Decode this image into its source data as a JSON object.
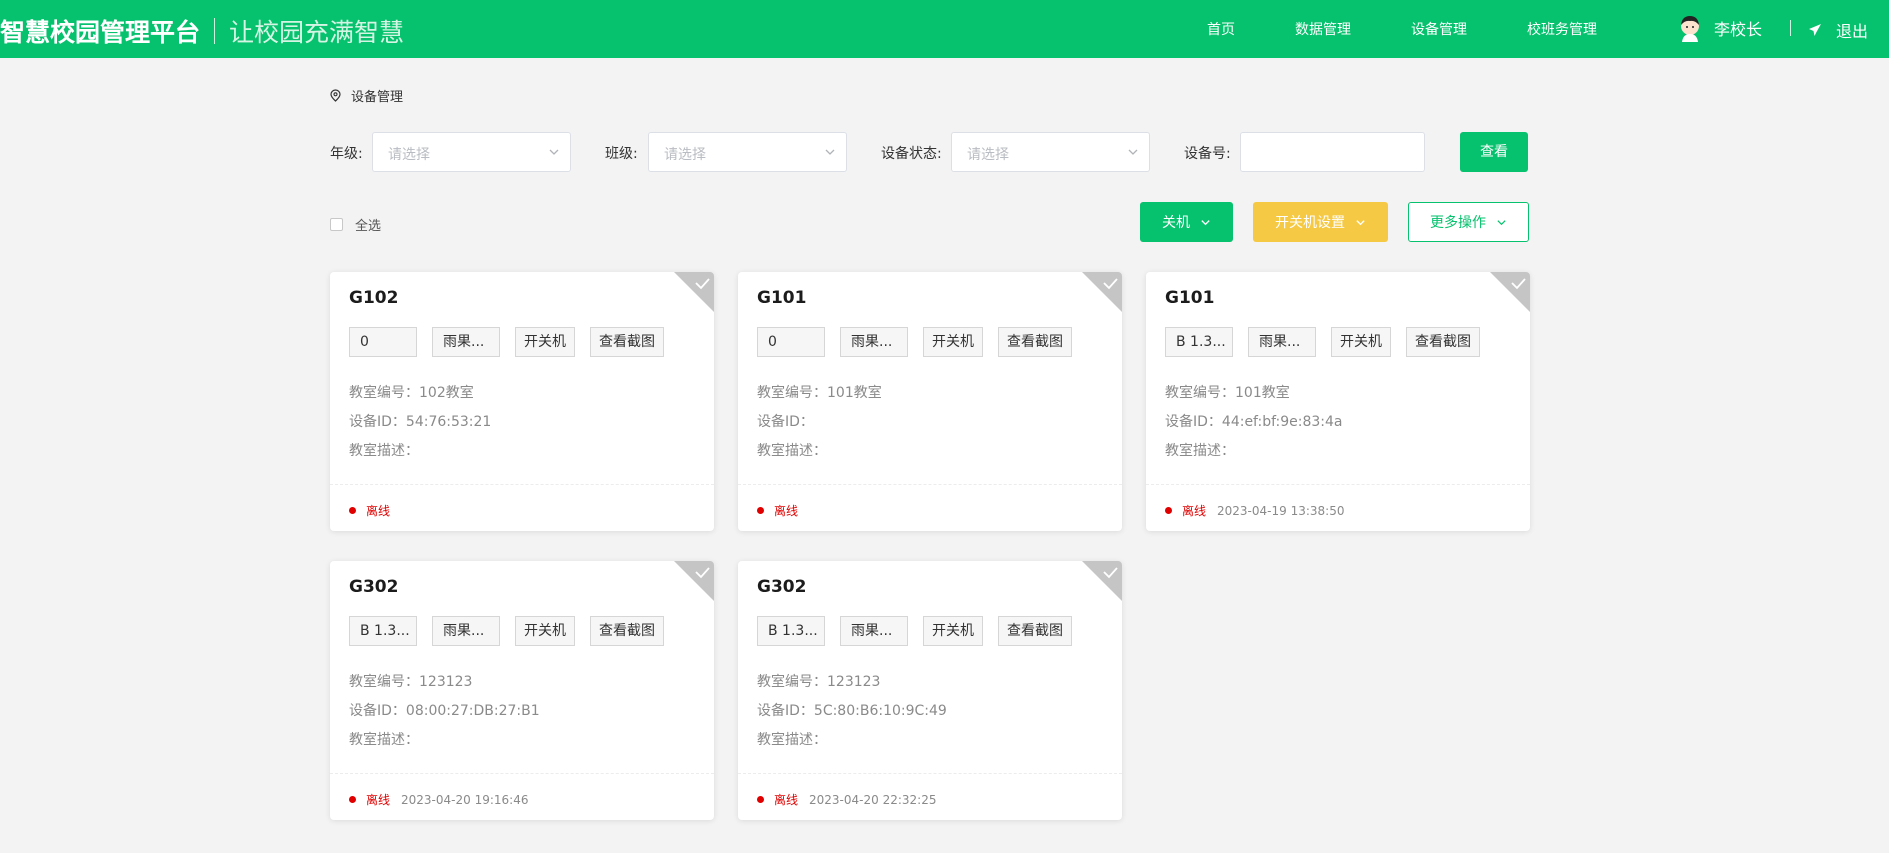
{
  "header": {
    "title": "智慧校园管理平台",
    "slogan": "让校园充满智慧",
    "nav": [
      "首页",
      "数据管理",
      "设备管理",
      "校班务管理"
    ],
    "user_name": "李校长",
    "logout": "退出",
    "icons": {
      "avatar": "user-avatar",
      "logout": "paper-plane-icon"
    }
  },
  "breadcrumb": {
    "icon": "location-pin-icon",
    "text": "设备管理"
  },
  "filters": {
    "grade_label": "年级:",
    "grade_placeholder": "请选择",
    "class_label": "班级:",
    "class_placeholder": "请选择",
    "status_label": "设备状态:",
    "status_placeholder": "请选择",
    "device_label": "设备号:",
    "device_value": "",
    "search_button": "查看"
  },
  "actions": {
    "select_all": "全选",
    "power_off": "关机",
    "schedule": "开关机设置",
    "more": "更多操作"
  },
  "colors": {
    "primary": "#06c16d",
    "warning": "#f6c944",
    "offline": "#e00000"
  },
  "cards": [
    {
      "title": "G102",
      "chip1": "0",
      "chip2": "雨果...",
      "chip3": "开关机",
      "chip4": "查看截图",
      "room": "教室编号：102教室",
      "device_id": "设备ID：54:76:53:21",
      "desc": "教室描述：",
      "status": "离线",
      "time": ""
    },
    {
      "title": "G101",
      "chip1": "0",
      "chip2": "雨果...",
      "chip3": "开关机",
      "chip4": "查看截图",
      "room": "教室编号：101教室",
      "device_id": "设备ID：",
      "desc": "教室描述：",
      "status": "离线",
      "time": ""
    },
    {
      "title": "G101",
      "chip1": "B 1.3...",
      "chip2": "雨果...",
      "chip3": "开关机",
      "chip4": "查看截图",
      "room": "教室编号：101教室",
      "device_id": "设备ID：44:ef:bf:9e:83:4a",
      "desc": "教室描述：",
      "status": "离线",
      "time": "2023-04-19 13:38:50"
    },
    {
      "title": "G302",
      "chip1": "B 1.3...",
      "chip2": "雨果...",
      "chip3": "开关机",
      "chip4": "查看截图",
      "room": "教室编号：123123",
      "device_id": "设备ID：08:00:27:DB:27:B1",
      "desc": "教室描述：",
      "status": "离线",
      "time": "2023-04-20 19:16:46"
    },
    {
      "title": "G302",
      "chip1": "B 1.3...",
      "chip2": "雨果...",
      "chip3": "开关机",
      "chip4": "查看截图",
      "room": "教室编号：123123",
      "device_id": "设备ID：5C:80:B6:10:9C:49",
      "desc": "教室描述：",
      "status": "离线",
      "time": "2023-04-20 22:32:25"
    }
  ]
}
